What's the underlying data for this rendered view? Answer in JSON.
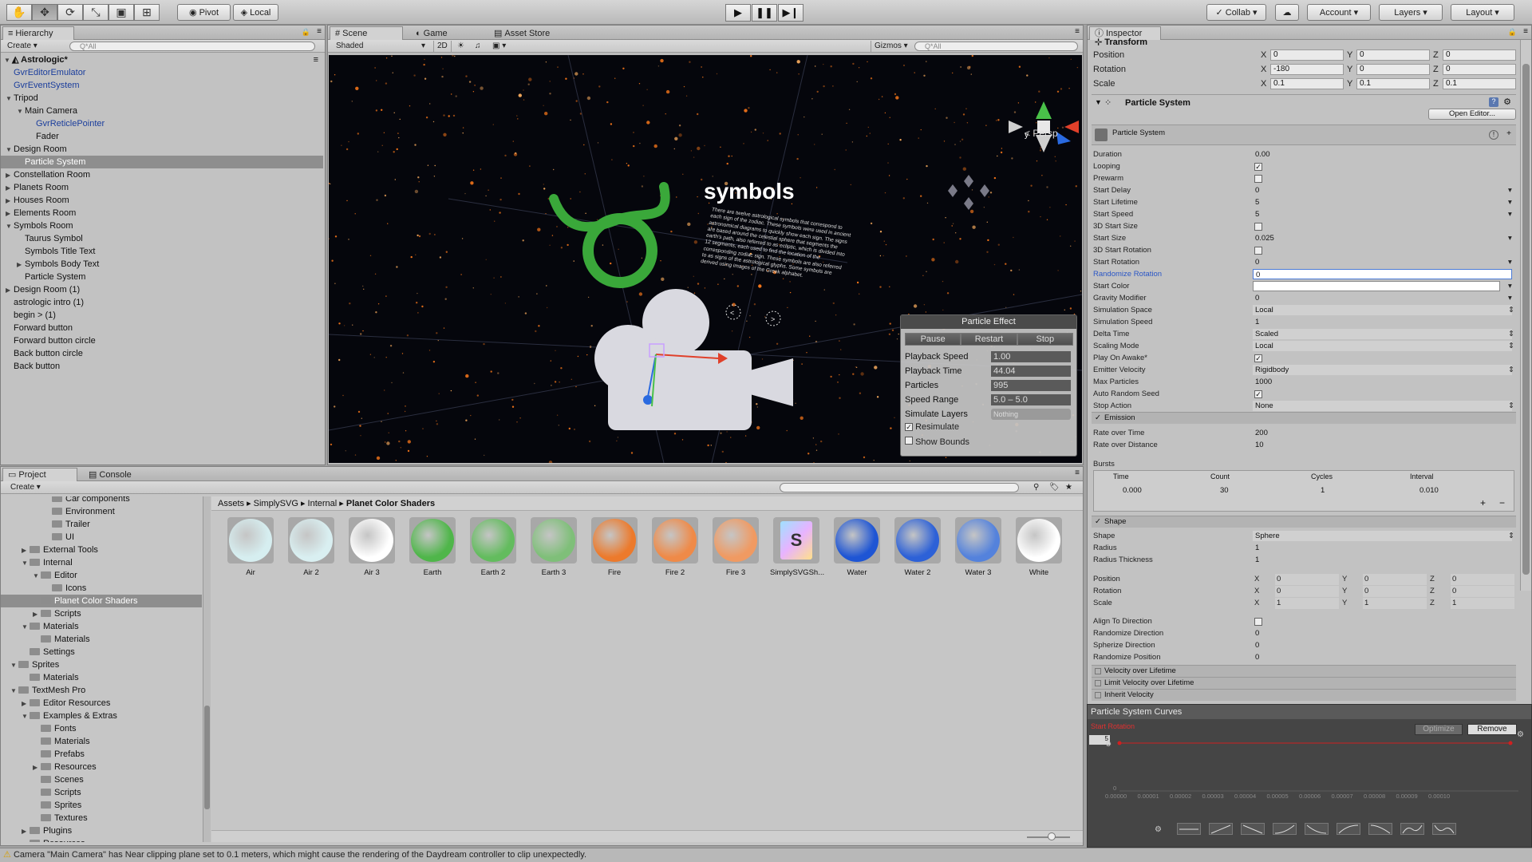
{
  "toolbar": {
    "pivot": "Pivot",
    "local": "Local",
    "collab": "Collab",
    "account": "Account",
    "layers": "Layers",
    "layout": "Layout"
  },
  "hierarchy": {
    "tab": "Hierarchy",
    "create": "Create",
    "search_placeholder": "Q*All",
    "scene_name": "Astrologic*",
    "rows": [
      {
        "label": "GvrEditorEmulator",
        "indent": 1,
        "arrow": "",
        "blue": true
      },
      {
        "label": "GvrEventSystem",
        "indent": 1,
        "arrow": "",
        "blue": true
      },
      {
        "label": "Tripod",
        "indent": 1,
        "arrow": "▼"
      },
      {
        "label": "Main Camera",
        "indent": 2,
        "arrow": "▼"
      },
      {
        "label": "GvrReticlePointer",
        "indent": 3,
        "arrow": "",
        "blue": true
      },
      {
        "label": "Fader",
        "indent": 3,
        "arrow": ""
      },
      {
        "label": "Design Room",
        "indent": 1,
        "arrow": "▼"
      },
      {
        "label": "Particle System",
        "indent": 2,
        "arrow": "",
        "selected": true
      },
      {
        "label": "Constellation Room",
        "indent": 1,
        "arrow": "▶"
      },
      {
        "label": "Planets Room",
        "indent": 1,
        "arrow": "▶"
      },
      {
        "label": "Houses Room",
        "indent": 1,
        "arrow": "▶"
      },
      {
        "label": "Elements Room",
        "indent": 1,
        "arrow": "▶"
      },
      {
        "label": "Symbols Room",
        "indent": 1,
        "arrow": "▼"
      },
      {
        "label": "Taurus Symbol",
        "indent": 2,
        "arrow": ""
      },
      {
        "label": "Symbols Title Text",
        "indent": 2,
        "arrow": ""
      },
      {
        "label": "Symbols Body Text",
        "indent": 2,
        "arrow": "▶"
      },
      {
        "label": "Particle System",
        "indent": 2,
        "arrow": ""
      },
      {
        "label": "Design Room (1)",
        "indent": 1,
        "arrow": "▶"
      },
      {
        "label": "astrologic intro (1)",
        "indent": 1,
        "arrow": ""
      },
      {
        "label": "begin > (1)",
        "indent": 1,
        "arrow": ""
      },
      {
        "label": "Forward button",
        "indent": 1,
        "arrow": ""
      },
      {
        "label": "Forward button circle",
        "indent": 1,
        "arrow": ""
      },
      {
        "label": "Back button circle",
        "indent": 1,
        "arrow": ""
      },
      {
        "label": "Back button",
        "indent": 1,
        "arrow": ""
      }
    ]
  },
  "scene": {
    "tabs": [
      "Scene",
      "Game",
      "Asset Store"
    ],
    "shading": "Shaded",
    "mode2d": "2D",
    "gizmos": "Gizmos",
    "search_placeholder": "Q*All",
    "persp": "Persp",
    "title_text": "symbols",
    "body_text": "There are twelve astrological symbols that correspond to each sign of the zodiac. These symbols were used in ancient astronomical diagrams to quickly show each sign. The signs are based around the celestial sphere that segments the earth's path, also referred to as ecliptic, which is divided into 12 segments, each used to find the location of the corresponding zodiac sign. These symbols are also referred to as signs of the astrological glyphs. Some symbols are derived using images of the Greek alphabet."
  },
  "particle_effect": {
    "title": "Particle Effect",
    "buttons": [
      "Pause",
      "Restart",
      "Stop"
    ],
    "rows": [
      {
        "label": "Playback Speed",
        "value": "1.00"
      },
      {
        "label": "Playback Time",
        "value": "44.04"
      },
      {
        "label": "Particles",
        "value": "995"
      },
      {
        "label": "Speed Range",
        "value": "5.0 – 5.0"
      },
      {
        "label": "Simulate Layers",
        "value": "Nothing"
      }
    ],
    "resimulate": "Resimulate",
    "show_bounds": "Show Bounds"
  },
  "project": {
    "tabs": [
      "Project",
      "Console"
    ],
    "create": "Create",
    "breadcrumb": [
      "Assets",
      "SimplySVG",
      "Internal",
      "Planet Color Shaders"
    ],
    "tree": [
      {
        "label": "Car components",
        "indent": 4,
        "arrow": ""
      },
      {
        "label": "Environment",
        "indent": 4,
        "arrow": ""
      },
      {
        "label": "Trailer",
        "indent": 4,
        "arrow": ""
      },
      {
        "label": "UI",
        "indent": 4,
        "arrow": ""
      },
      {
        "label": "External Tools",
        "indent": 2,
        "arrow": "▶"
      },
      {
        "label": "Internal",
        "indent": 2,
        "arrow": "▼"
      },
      {
        "label": "Editor",
        "indent": 3,
        "arrow": "▼"
      },
      {
        "label": "Icons",
        "indent": 4,
        "arrow": ""
      },
      {
        "label": "Planet Color Shaders",
        "indent": 3,
        "arrow": "",
        "selected": true
      },
      {
        "label": "Scripts",
        "indent": 3,
        "arrow": "▶"
      },
      {
        "label": "Materials",
        "indent": 2,
        "arrow": "▼"
      },
      {
        "label": "Materials",
        "indent": 3,
        "arrow": ""
      },
      {
        "label": "Settings",
        "indent": 2,
        "arrow": ""
      },
      {
        "label": "Sprites",
        "indent": 1,
        "arrow": "▼"
      },
      {
        "label": "Materials",
        "indent": 2,
        "arrow": ""
      },
      {
        "label": "TextMesh Pro",
        "indent": 1,
        "arrow": "▼"
      },
      {
        "label": "Editor Resources",
        "indent": 2,
        "arrow": "▶"
      },
      {
        "label": "Examples & Extras",
        "indent": 2,
        "arrow": "▼"
      },
      {
        "label": "Fonts",
        "indent": 3,
        "arrow": ""
      },
      {
        "label": "Materials",
        "indent": 3,
        "arrow": ""
      },
      {
        "label": "Prefabs",
        "indent": 3,
        "arrow": ""
      },
      {
        "label": "Resources",
        "indent": 3,
        "arrow": "▶"
      },
      {
        "label": "Scenes",
        "indent": 3,
        "arrow": ""
      },
      {
        "label": "Scripts",
        "indent": 3,
        "arrow": ""
      },
      {
        "label": "Sprites",
        "indent": 3,
        "arrow": ""
      },
      {
        "label": "Textures",
        "indent": 3,
        "arrow": ""
      },
      {
        "label": "Plugins",
        "indent": 2,
        "arrow": "▶"
      },
      {
        "label": "Resources",
        "indent": 2,
        "arrow": "▼"
      }
    ],
    "assets": [
      {
        "label": "Air",
        "color": "#d6eef0"
      },
      {
        "label": "Air 2",
        "color": "#d9eff1"
      },
      {
        "label": "Air 3",
        "color": "#ffffff"
      },
      {
        "label": "Earth",
        "color": "#4fb64a"
      },
      {
        "label": "Earth 2",
        "color": "#63bc5e"
      },
      {
        "label": "Earth 3",
        "color": "#7fbf79"
      },
      {
        "label": "Fire",
        "color": "#ec7a2c"
      },
      {
        "label": "Fire 2",
        "color": "#ef8a48"
      },
      {
        "label": "Fire 3",
        "color": "#f09a62"
      },
      {
        "label": "SimplySVGSh...",
        "color": "svg"
      },
      {
        "label": "Water",
        "color": "#1e55d4"
      },
      {
        "label": "Water 2",
        "color": "#2d61d7"
      },
      {
        "label": "Water 3",
        "color": "#5482dc"
      },
      {
        "label": "White",
        "color": "#ffffff"
      }
    ]
  },
  "inspector": {
    "tab": "Inspector",
    "transform": {
      "title": "Transform",
      "rows": [
        {
          "label": "Position",
          "x": "0",
          "y": "0",
          "z": "0"
        },
        {
          "label": "Rotation",
          "x": "-180",
          "y": "0",
          "z": "0"
        },
        {
          "label": "Scale",
          "x": "0.1",
          "y": "0.1",
          "z": "0.1"
        }
      ]
    },
    "component": "Particle System",
    "open_editor": "Open Editor...",
    "module_title": "Particle System",
    "props": [
      {
        "label": "Duration",
        "value": "0.00"
      },
      {
        "label": "Looping",
        "check": true
      },
      {
        "label": "Prewarm",
        "check": false
      },
      {
        "label": "Start Delay",
        "value": "0",
        "dd": true
      },
      {
        "label": "Start Lifetime",
        "value": "5",
        "dd": true
      },
      {
        "label": "Start Speed",
        "value": "5",
        "dd": true
      },
      {
        "label": "3D Start Size",
        "check": false
      },
      {
        "label": "Start Size",
        "value": "0.025",
        "dd": true
      },
      {
        "label": "3D Start Rotation",
        "check": false
      },
      {
        "label": "Start Rotation",
        "value": "0",
        "dd": true
      },
      {
        "label": "Randomize Rotation",
        "value": "0",
        "focused": true
      },
      {
        "label": "Start Color",
        "value": "",
        "color": true
      },
      {
        "label": "Gravity Modifier",
        "value": "0",
        "dd": true
      },
      {
        "label": "Simulation Space",
        "value": "Local",
        "sel": true
      },
      {
        "label": "Simulation Speed",
        "value": "1"
      },
      {
        "label": "Delta Time",
        "value": "Scaled",
        "sel": true
      },
      {
        "label": "Scaling Mode",
        "value": "Local",
        "sel": true
      },
      {
        "label": "Play On Awake*",
        "check": true
      },
      {
        "label": "Emitter Velocity",
        "value": "Rigidbody",
        "sel": true
      },
      {
        "label": "Max Particles",
        "value": "1000"
      },
      {
        "label": "Auto Random Seed",
        "check": true
      },
      {
        "label": "Stop Action",
        "value": "None",
        "sel": true
      }
    ],
    "emission": {
      "title": "Emission",
      "rows": [
        {
          "label": "Rate over Time",
          "value": "200"
        },
        {
          "label": "Rate over Distance",
          "value": "10"
        }
      ],
      "bursts_label": "Bursts",
      "burst_headers": [
        "Time",
        "Count",
        "Cycles",
        "Interval"
      ],
      "burst_values": [
        "0.000",
        "30",
        "1",
        "0.010"
      ]
    },
    "shape": {
      "title": "Shape",
      "rows": [
        {
          "label": "Shape",
          "value": "Sphere"
        },
        {
          "label": "Radius",
          "value": "1"
        },
        {
          "label": "Radius Thickness",
          "value": "1"
        }
      ],
      "xyz": [
        {
          "label": "Position",
          "x": "0",
          "y": "0",
          "z": "0"
        },
        {
          "label": "Rotation",
          "x": "0",
          "y": "0",
          "z": "0"
        },
        {
          "label": "Scale",
          "x": "1",
          "y": "1",
          "z": "1"
        }
      ],
      "rows2": [
        {
          "label": "Align To Direction",
          "check": false
        },
        {
          "label": "Randomize Direction",
          "value": "0"
        },
        {
          "label": "Spherize Direction",
          "value": "0"
        },
        {
          "label": "Randomize Position",
          "value": "0"
        }
      ]
    },
    "modules": [
      "Velocity over Lifetime",
      "Limit Velocity over Lifetime",
      "Inherit Velocity"
    ]
  },
  "curves": {
    "title": "Particle System Curves",
    "curve_label": "Start Rotation",
    "optimize": "Optimize",
    "remove": "Remove",
    "x_ticks": [
      "0.00000",
      "0.00001",
      "0.00002",
      "0.00003",
      "0.00004",
      "0.00005",
      "0.00006",
      "0.00007",
      "0.00008",
      "0.00009",
      "0.00010"
    ],
    "y_tick": "0",
    "value_box": "5"
  },
  "status": {
    "message": "Camera \"Main Camera\" has Near clipping plane set to 0.1 meters, which might cause the rendering of the Daydream controller to clip unexpectedly."
  }
}
